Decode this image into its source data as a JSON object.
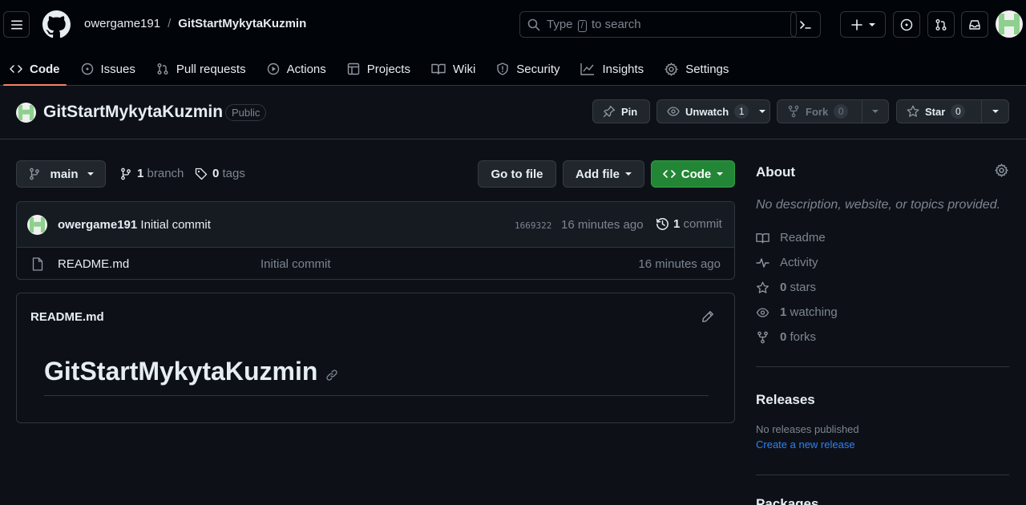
{
  "header": {
    "owner": "owergame191",
    "separator": "/",
    "repo": "GitStartMykytaKuzmin",
    "search_prefix": "Type",
    "search_key": "/",
    "search_suffix": "to search"
  },
  "tabs": [
    {
      "label": "Code",
      "icon": "code-icon"
    },
    {
      "label": "Issues",
      "icon": "issue-icon"
    },
    {
      "label": "Pull requests",
      "icon": "pull-request-icon"
    },
    {
      "label": "Actions",
      "icon": "play-icon"
    },
    {
      "label": "Projects",
      "icon": "table-icon"
    },
    {
      "label": "Wiki",
      "icon": "book-icon"
    },
    {
      "label": "Security",
      "icon": "shield-icon"
    },
    {
      "label": "Insights",
      "icon": "graph-icon"
    },
    {
      "label": "Settings",
      "icon": "gear-icon"
    }
  ],
  "repo": {
    "name": "GitStartMykytaKuzmin",
    "visibility": "Public",
    "pin_label": "Pin",
    "watch_label": "Unwatch",
    "watch_count": "1",
    "fork_label": "Fork",
    "fork_count": "0",
    "star_label": "Star",
    "star_count": "0"
  },
  "toolbar": {
    "branch": "main",
    "branch_count": "1",
    "branch_word": "branch",
    "tag_count": "0",
    "tag_word": "tags",
    "go_to_file": "Go to file",
    "add_file": "Add file",
    "code": "Code"
  },
  "commit": {
    "author": "owergame191",
    "message": "Initial commit",
    "hash": "1669322",
    "time": "16 minutes ago",
    "count": "1",
    "count_word": "commit"
  },
  "files": [
    {
      "name": "README.md",
      "message": "Initial commit",
      "time": "16 minutes ago"
    }
  ],
  "readme": {
    "filename": "README.md",
    "heading": "GitStartMykytaKuzmin"
  },
  "about": {
    "title": "About",
    "description": "No description, website, or topics provided.",
    "readme": "Readme",
    "activity": "Activity",
    "stars_count": "0",
    "stars_word": "stars",
    "watching_count": "1",
    "watching_word": "watching",
    "forks_count": "0",
    "forks_word": "forks"
  },
  "releases": {
    "title": "Releases",
    "none": "No releases published",
    "create_link": "Create a new release"
  },
  "packages": {
    "title": "Packages"
  },
  "colors": {
    "accent_green": "#238636",
    "tab_underline": "#f78166",
    "link_blue": "#2f81f7"
  }
}
